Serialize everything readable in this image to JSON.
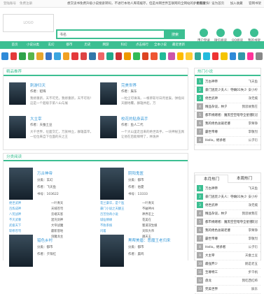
{
  "topbar": {
    "links": [
      "登陆账号",
      "免费注册"
    ],
    "notice": "想交读书免费升级小说搜索转码，不进行本地人库或缓存，但是州网世界互联网的全网站的，更新爱快！",
    "right": [
      "手机看版",
      "设为首页",
      "加入收藏",
      "官网书架"
    ]
  },
  "header": {
    "logo": "LOGO",
    "select": "书名",
    "search_button": "搜索",
    "icons": [
      "用户登录",
      "微信阅读",
      "QQ阅读",
      "我的书架"
    ]
  },
  "nav": [
    "首页",
    "小说分类",
    "玄幻",
    "都市",
    "历史",
    "网游",
    "科幻",
    "点击排行",
    "全本小说",
    "最近更新"
  ],
  "iconrow_colors": [
    "#2e8ad8",
    "#e43a3a",
    "#2fa34a",
    "#58b54c",
    "#e8a52e",
    "#3a76c7",
    "#3aa5e0",
    "#f1a123",
    "#e4393c",
    "#d44",
    "#37a",
    "#e66",
    "#2a8",
    "#c33",
    "#e90",
    "#3b5",
    "#d42",
    "#e53",
    "#2b9",
    "#c5a",
    "#fb0",
    "#fc3",
    "#3a9",
    "#2bd",
    "#e33",
    "#f5c400",
    "#2e8ad8",
    "#39a",
    "#f39",
    "#888"
  ],
  "recommend": {
    "title": "精品推荐",
    "items": [
      {
        "title": "刺游归天",
        "author": "作者：貂嗨",
        "desc": "我修重新，天不可无，我修重新，天不可有！这是一个超级于第八山与展"
      },
      {
        "title": "完美世界",
        "author": "作者：辰东",
        "desc": "一粒尘可填海，一根草斩尽日月星辰，弹指间天翻地覆。群雄并起，万"
      },
      {
        "title": "大主宰",
        "author": "作者：天蚕土豆",
        "desc": "大千世界，位面交汇，万族林立，群雄荟萃，一位位来自下位面的天之王"
      },
      {
        "title": "校花的贴身高手",
        "author": "作者：鱼人二代",
        "desc": "一个大山里走出来的绝世高手，一块神秘玉佩让他在后能纲特了，林逸并"
      }
    ]
  },
  "hotlist": {
    "title": "热门小说",
    "rows": [
      {
        "n": "1",
        "name": "万古神帝",
        "author": "飞天鱼"
      },
      {
        "n": "2",
        "name": "豪门逃荒少夫人：夺嫡01失少",
        "author": "安小柠"
      },
      {
        "n": "3",
        "name": "绝世武神",
        "author": "净无痕"
      },
      {
        "n": "4",
        "name": "精品杂谈，林夕",
        "author": "我思故我在"
      },
      {
        "n": "5",
        "name": "都市捐赠者：魔黑空空暗夺全星兽",
        "author": "莫冠"
      },
      {
        "n": "6",
        "name": "我的绝色总裁老婆",
        "author": "李栗铮"
      },
      {
        "n": "7",
        "name": "霸世帝尊",
        "author": "李敬烈"
      },
      {
        "n": "8",
        "name": "Hello，继承者",
        "author": "公子衍"
      }
    ]
  },
  "category": {
    "title": "分类阅读",
    "items": [
      {
        "title": "万古神帝",
        "cat": "分类：玄幻",
        "author": "作者：飞天鱼",
        "code": "书号：103622",
        "links": [
          "绝世武神",
          "一叶青天",
          "百炼成神",
          "天域苍穹",
          "八荒战神",
          "云端天客",
          "不灭武尊",
          "混沌剑神",
          "武极天下",
          "大帝战魔",
          "斩修苍穹",
          "最新冒地",
          "极破龙神",
          "剑魔龙主"
        ]
      },
      {
        "title": "阴阳鬼医",
        "cat": "分类：都市",
        "author": "作者：伯夏",
        "code": "书号：13333",
        "links": [
          "花兰豪华，是个医",
          "一叶青天",
          "豪门小说之天翻王",
          "不破神州",
          "百苦伪奇小说",
          "神界宏上",
          "城仙情缘",
          "花美在",
          "不败系统",
          "蜀道双生娘",
          "闪着",
          "天阳大帝",
          "红鸾学院",
          "遍天王"
        ]
      },
      {
        "title": "猎色乡村",
        "cat": "分类：都市",
        "author": "作者：夕阳红"
      },
      {
        "title": "黑帮美眉：恶魔王老归来",
        "cat": "分类：都市",
        "author": "作者：晨鸣"
      }
    ]
  },
  "monthly": {
    "tabs": [
      "本月热门",
      "本周热门"
    ],
    "rows": [
      {
        "n": "1",
        "name": "万古神帝",
        "author": "飞天鱼"
      },
      {
        "n": "2",
        "name": "豪门逃荒少夫人：夺嫡01失少",
        "author": "安小柠"
      },
      {
        "n": "3",
        "name": "绝世武神",
        "author": "净无痕"
      },
      {
        "n": "4",
        "name": "精品杂谈，林夕",
        "author": "我思故我在"
      },
      {
        "n": "5",
        "name": "都市捐赠者：魔黑空空暗夺全星兽",
        "author": "莫冠"
      },
      {
        "n": "6",
        "name": "我的绝色总裁老婆",
        "author": "李栗铮"
      },
      {
        "n": "7",
        "name": "霸世帝尊",
        "author": "李敬烈"
      },
      {
        "n": "8",
        "name": "Hello，继承者",
        "author": "公子衍"
      },
      {
        "n": "9",
        "name": "大主宰",
        "author": "天蚕土豆"
      },
      {
        "n": "10",
        "name": "最强弃少",
        "author": "鹅是老五"
      },
      {
        "n": "11",
        "name": "至尊特工",
        "author": "步千帆"
      },
      {
        "n": "12",
        "name": "盘龙",
        "author": "我吃西红柿"
      },
      {
        "n": "13",
        "name": "完美世界",
        "author": "辰东"
      }
    ]
  }
}
